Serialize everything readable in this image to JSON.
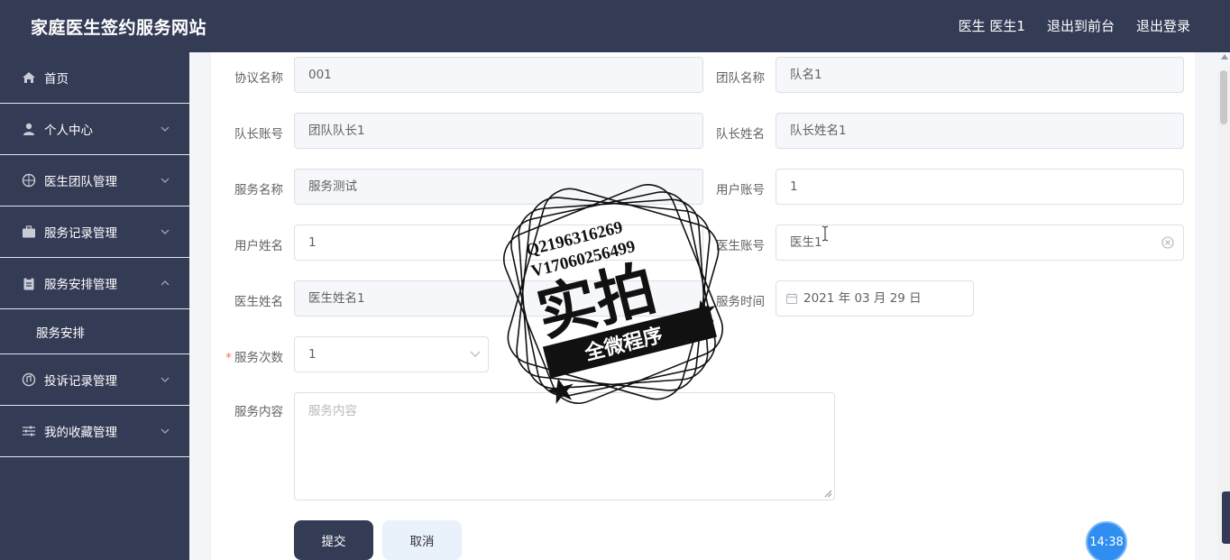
{
  "header": {
    "site_title": "家庭医生签约服务网站",
    "user_label": "医生 医生1",
    "front_link": "退出到前台",
    "logout_link": "退出登录"
  },
  "sidebar": {
    "items": [
      {
        "label": "首页",
        "icon": "home-icon"
      },
      {
        "label": "个人中心",
        "icon": "user-icon"
      },
      {
        "label": "医生团队管理",
        "icon": "team-icon"
      },
      {
        "label": "服务记录管理",
        "icon": "briefcase-icon"
      },
      {
        "label": "服务安排管理",
        "icon": "clipboard-icon",
        "expanded": true,
        "children": [
          {
            "label": "服务安排"
          }
        ]
      },
      {
        "label": "投诉记录管理",
        "icon": "complaint-icon"
      },
      {
        "label": "我的收藏管理",
        "icon": "sliders-icon"
      }
    ]
  },
  "form": {
    "agreement_name": {
      "label": "协议名称",
      "value": "001"
    },
    "team_name": {
      "label": "团队名称",
      "value": "队名1"
    },
    "captain_account": {
      "label": "队长账号",
      "value": "团队队长1"
    },
    "captain_name": {
      "label": "队长姓名",
      "value": "队长姓名1"
    },
    "service_name": {
      "label": "服务名称",
      "value": "服务测试"
    },
    "user_account": {
      "label": "用户账号",
      "value": "1"
    },
    "user_name": {
      "label": "用户姓名",
      "value": "1"
    },
    "doctor_account": {
      "label": "医生账号",
      "value": "医生1"
    },
    "doctor_name": {
      "label": "医生姓名",
      "value": "医生姓名1"
    },
    "service_time": {
      "label": "服务时间",
      "value": "2021 年 03 月 29 日"
    },
    "service_count": {
      "label": "服务次数",
      "value": "1",
      "required_mark": "*"
    },
    "service_content": {
      "label": "服务内容",
      "placeholder": "服务内容"
    }
  },
  "buttons": {
    "submit": "提交",
    "cancel": "取消"
  },
  "overlay": {
    "time": "14:38",
    "stamp_lines": [
      "Q2196316269",
      "V17060256499",
      "实拍",
      "全微程序"
    ]
  },
  "colors": {
    "primary_dark": "#343b55",
    "cancel_bg": "#e9f1fb",
    "time_badge": "#2f8ef0",
    "required": "#f56c6c"
  }
}
